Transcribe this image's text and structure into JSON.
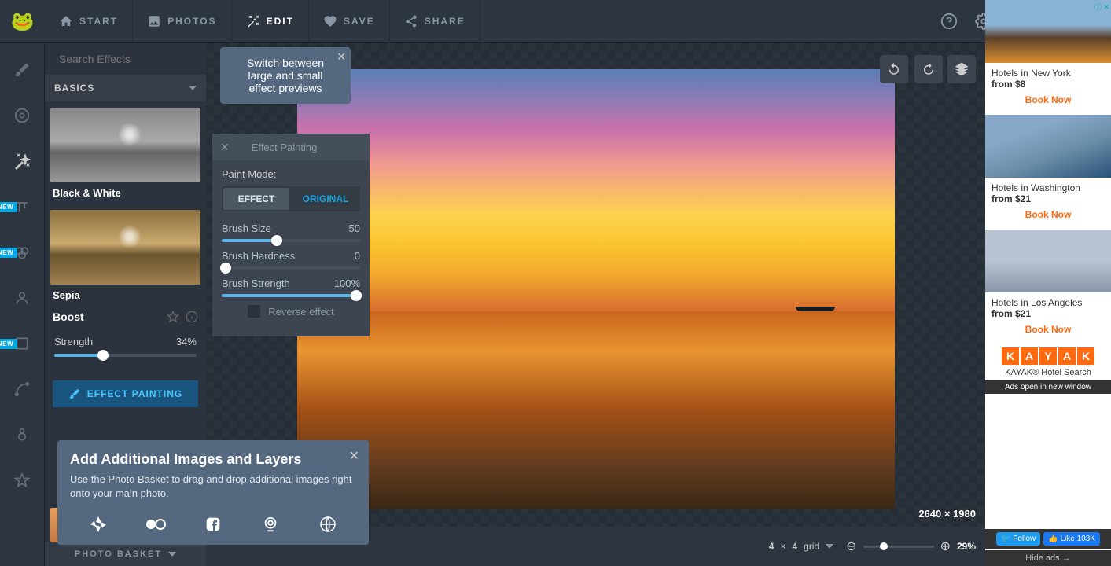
{
  "nav": {
    "start": "START",
    "photos": "PHOTOS",
    "edit": "EDIT",
    "save": "SAVE",
    "share": "SHARE"
  },
  "rail": {
    "new": "NEW"
  },
  "sidebar": {
    "search_placeholder": "Search Effects",
    "category": "BASICS",
    "effects": {
      "bw": "Black & White",
      "sepia": "Sepia",
      "boost": "Boost"
    },
    "strength_label": "Strength",
    "strength_value": "34%",
    "painting_btn": "EFFECT PAINTING",
    "basket": "PHOTO BASKET"
  },
  "tooltip_preview": {
    "text": "Switch between large and small effect previews"
  },
  "effect_panel": {
    "title": "Effect Painting",
    "paint_mode": "Paint Mode:",
    "effect": "EFFECT",
    "original": "ORIGINAL",
    "brush_size": "Brush Size",
    "brush_size_val": "50",
    "brush_hardness": "Brush Hardness",
    "brush_hardness_val": "0",
    "brush_strength": "Brush Strength",
    "brush_strength_val": "100%",
    "reverse": "Reverse effect"
  },
  "add_popover": {
    "title": "Add Additional Images and Layers",
    "body": "Use the Photo Basket to drag and drop additional images right onto your main photo."
  },
  "hud": {
    "grid_a": "4",
    "grid_times": "×",
    "grid_b": "4",
    "grid_label": "grid",
    "dim_w": "2640",
    "dim_x": "×",
    "dim_h": "1980",
    "zoom": "29%"
  },
  "ads": {
    "corner": "ⓘ ✕",
    "cards": [
      {
        "title": "Hotels in New York",
        "price": "from $8",
        "book": "Book Now"
      },
      {
        "title": "Hotels in Washington",
        "price": "from $21",
        "book": "Book Now"
      },
      {
        "title": "Hotels in Los Angeles",
        "price": "from $21",
        "book": "Book Now"
      }
    ],
    "kayak_name": "KAYAK® Hotel Search",
    "note": "Ads open in new window",
    "follow": "Follow",
    "like": "Like 103K",
    "hide": "Hide ads →"
  }
}
